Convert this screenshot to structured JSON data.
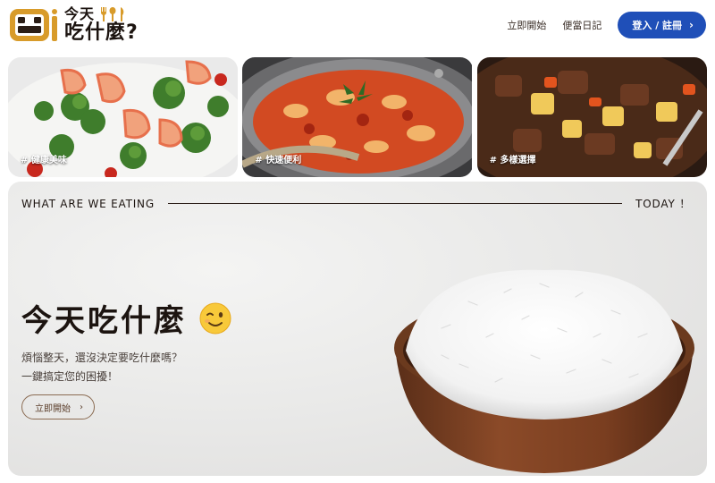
{
  "brand": {
    "logo_line1": "今天",
    "logo_line2": "吃什麼?",
    "logo_icon": "bento-box-icon",
    "utensil_icons": [
      "fork-icon",
      "spoon-icon",
      "knife-icon"
    ]
  },
  "nav": {
    "items": [
      {
        "label": "立即開始"
      },
      {
        "label": "便當日記"
      }
    ],
    "login_label": "登入 / 註冊",
    "login_icon": "chevron-right-icon"
  },
  "cards": [
    {
      "tag": "# 健康美味",
      "image": "shrimp-broccoli"
    },
    {
      "tag": "# 快速便利",
      "image": "tomato-egg-pan"
    },
    {
      "tag": "# 多樣選擇",
      "image": "beef-stew"
    }
  ],
  "hero": {
    "left_label": "WHAT ARE WE EATING",
    "right_label": "TODAY ！",
    "title": "今天吃什麼",
    "emoji": "winking-face-icon",
    "subtitle_line1": "煩惱整天，還沒決定要吃什麼嗎？",
    "subtitle_line2": "一鍵搞定您的困擾！",
    "cta_label": "立即開始",
    "image": "rice-bowl"
  },
  "colors": {
    "accent": "#1f4fb8",
    "logo_gold": "#d89b2a",
    "text_dark": "#1c1410",
    "cta_border": "#8a6b52"
  }
}
